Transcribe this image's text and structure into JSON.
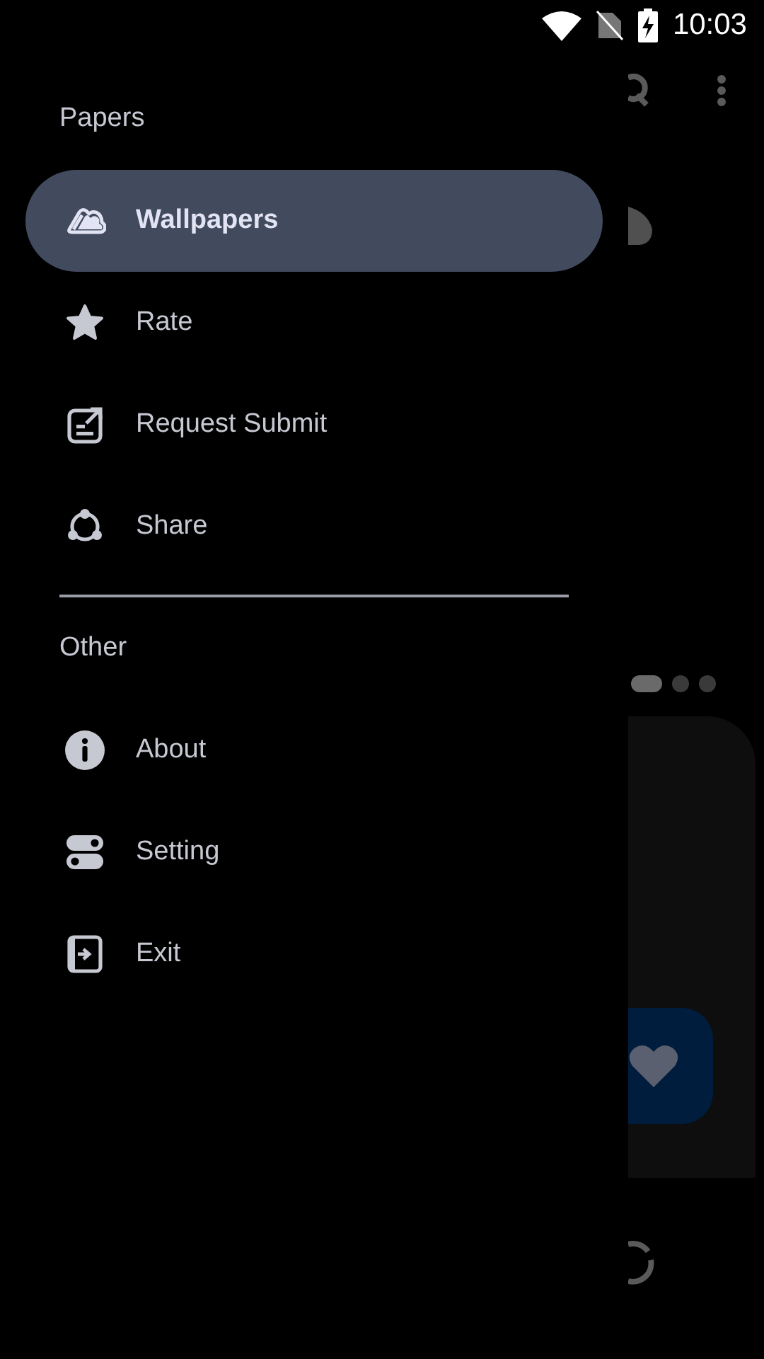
{
  "status_bar": {
    "time": "10:03"
  },
  "drawer": {
    "sections": [
      {
        "title": "Papers",
        "items": [
          {
            "label": "Wallpapers",
            "kind": "cloud",
            "selected": true
          },
          {
            "label": "Rate",
            "kind": "star",
            "selected": false
          },
          {
            "label": "Request Submit",
            "kind": "edit",
            "selected": false
          },
          {
            "label": "Share",
            "kind": "share",
            "selected": false
          }
        ]
      },
      {
        "title": "Other",
        "items": [
          {
            "label": "About",
            "kind": "info",
            "selected": false
          },
          {
            "label": "Setting",
            "kind": "toggles",
            "selected": false
          },
          {
            "label": "Exit",
            "kind": "exit",
            "selected": false
          }
        ]
      }
    ]
  },
  "background": {
    "pager": [
      {
        "selected": true
      },
      {
        "selected": false
      },
      {
        "selected": false
      }
    ]
  }
}
